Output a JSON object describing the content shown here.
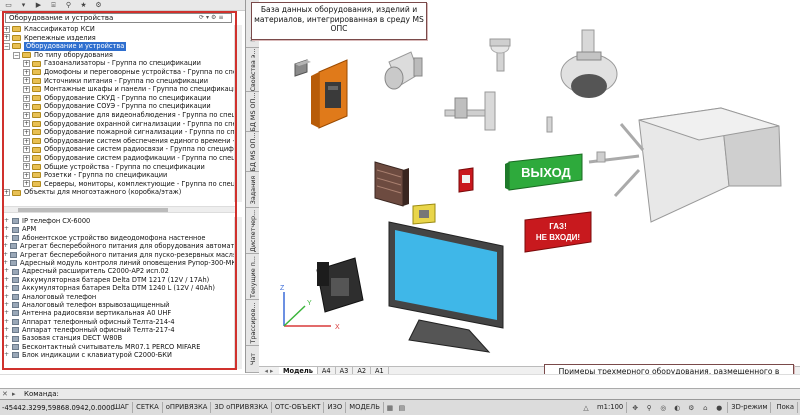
{
  "left_panel": {
    "combo_value": "Оборудование и устройства",
    "tree_upper": [
      {
        "label": "Классификатор КСИ",
        "level": 0,
        "exp": "+"
      },
      {
        "label": "Крепежные изделия",
        "level": 0,
        "exp": "+"
      },
      {
        "label": "Оборудование и устройства",
        "level": 0,
        "exp": "-",
        "selected": true
      },
      {
        "label": "По типу оборудования",
        "level": 1,
        "exp": "-"
      },
      {
        "label": "Газоанализаторы - Группа по спецификации",
        "level": 2,
        "exp": "+"
      },
      {
        "label": "Домофоны и переговорные устройства - Группа по спецификации",
        "level": 2,
        "exp": "+"
      },
      {
        "label": "Источники питания - Группа по спецификации",
        "level": 2,
        "exp": "+"
      },
      {
        "label": "Монтажные шкафы и панели - Группа по спецификации",
        "level": 2,
        "exp": "+"
      },
      {
        "label": "Оборудование СКУД - Группа по спецификации",
        "level": 2,
        "exp": "+"
      },
      {
        "label": "Оборудование СОУЭ - Группа по спецификации",
        "level": 2,
        "exp": "+"
      },
      {
        "label": "Оборудование для видеонаблюдения - Группа по специфик",
        "level": 2,
        "exp": "+"
      },
      {
        "label": "Оборудование охранной сигнализации - Группа по специфик",
        "level": 2,
        "exp": "+"
      },
      {
        "label": "Оборудование пожарной сигнализации - Группа по специфика",
        "level": 2,
        "exp": "+"
      },
      {
        "label": "Оборудование систем обеспечения единого времени - Групп",
        "level": 2,
        "exp": "+"
      },
      {
        "label": "Оборудование систем радиосвязи - Группа по спецификации",
        "level": 2,
        "exp": "+"
      },
      {
        "label": "Оборудование систем радиофикации - Группа по спецификац",
        "level": 2,
        "exp": "+"
      },
      {
        "label": "Общие устройства - Группа по спецификации",
        "level": 2,
        "exp": "+"
      },
      {
        "label": "Розетки - Группа по спецификации",
        "level": 2,
        "exp": "+"
      },
      {
        "label": "Серверы, мониторы, комплектующие - Группа по специфик",
        "level": 2,
        "exp": "+"
      },
      {
        "label": "Объекты для многоэтажного (коробка/этаж)",
        "level": 0,
        "exp": "+"
      }
    ],
    "list_lower": [
      "IP телефон CX-6000",
      "АРМ",
      "Абонентское устройство видеодомофона настенное",
      "Агрегат бесперебойного питания для оборудования автоматики",
      "Агрегат бесперебойного питания для пуско-резервных масляных насс",
      "Адресный модуль контроля линий оповещения Рупор-300-МК",
      "Адресный расширитель С2000-АР2 исп.02",
      "Аккумуляторная батарея Delta DTM 1217 (12V / 17Ah)",
      "Аккумуляторная батарея Delta DTM 1240 L (12V / 40Ah)",
      "Аналоговый телефон",
      "Аналоговый телефон взрывозащищенный",
      "Антенна радиосвязи вертикальная А0 UHF",
      "Аппарат телефонный офисный Телта-214-4",
      "Аппарат телефонный офисный Телта-217-4",
      "Базовая станция DECT W80B",
      "Бесконтактный считыватель MR07.1 PERCO MIFARE",
      "Блок индикации с клавиатурой С2000-БКИ"
    ]
  },
  "vertical_tabs": [
    "Навигатор",
    "Свойства э...",
    "БД MS ОП...",
    "БД MS ОП...",
    "Задания",
    "Диспетчер...",
    "Текущие п...",
    "Трассиров...",
    "Чат"
  ],
  "model_tabs": [
    "Модель",
    "A4",
    "A3",
    "A2",
    "A1"
  ],
  "callouts": {
    "top": "База данных оборудования, изделий и материалов, интегрированная в среду MS ОПС",
    "bottom": "Примеры трехмерного оборудования, размещенного в пространстве модели из базы данных"
  },
  "signs": {
    "exit": "ВЫХОД",
    "gas_line1": "ГАЗ!",
    "gas_line2": "НЕ ВХОДИ!"
  },
  "ucs": {
    "x": "X",
    "y": "Y",
    "z": "Z"
  },
  "command": {
    "label": "Команда:"
  },
  "status": {
    "coords": "-45442.3299,59868.0942,0.0000",
    "buttons": [
      "ШАГ",
      "СЕТКА",
      "оПРИВЯЗКА",
      "3D оПРИВЯЗКА",
      "ОТС-ОБЪЕКТ",
      "ИЗО",
      "МОДЕЛЬ"
    ],
    "scale": "m1:100",
    "mode": "3D-режим",
    "last": "Пока"
  },
  "colors": {
    "highlight": "#d0312d",
    "selection": "#2f6fcf",
    "exit_sign": "#2eaa3c",
    "gas_sign": "#c8191e"
  }
}
